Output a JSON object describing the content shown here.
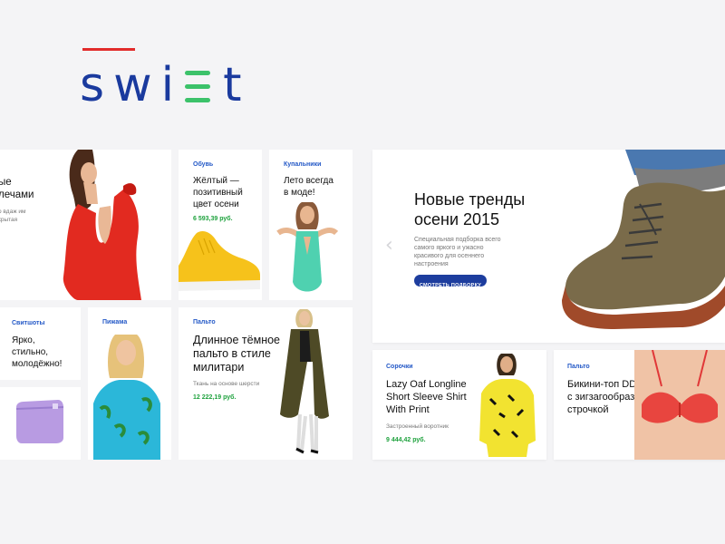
{
  "brand": {
    "letters_before": "sw",
    "letters_i": "i",
    "letters_after": "t",
    "color": "#1a3a9e",
    "accent_green": "#3cc26a",
    "accent_red": "#e22b2b"
  },
  "cards": {
    "hero_left": {
      "title_line1": "ые",
      "title_line2": "лечами",
      "sub_line1": "о вдаж им",
      "sub_line2": "крытая"
    },
    "shoes": {
      "category": "Обувь",
      "title_line1": "Жёлтый —",
      "title_line2": "позитивный",
      "title_line3": "цвет осени",
      "price": "6 593,39 руб."
    },
    "swimsuit": {
      "category": "Купальники",
      "title_line1": "Лето всегда",
      "title_line2": "в моде!"
    },
    "sweatshirt": {
      "category": "Свитшоты",
      "title_line1": "Ярко,",
      "title_line2": "стильно,",
      "title_line3": "молодёжно!"
    },
    "pajama": {
      "category": "Пижама"
    },
    "coat": {
      "category": "Пальто",
      "title_line1": "Длинное тёмное",
      "title_line2": "пальто в стиле",
      "title_line3": "милитари",
      "sub": "Ткань на основе шерсти",
      "price": "12 222,19 руб."
    },
    "hero": {
      "title_line1": "Новые тренды",
      "title_line2": "осени 2015",
      "sub_line1": "Специальная подборка всего",
      "sub_line2": "самого яркого и ужасно",
      "sub_line3": "красивого для осеннего",
      "sub_line4": "настроения",
      "button": "СМОТРЕТЬ ПОДБОРКУ",
      "prev_arrow": "‹"
    },
    "shirt": {
      "category": "Сорочки",
      "title_line1": "Lazy Oaf Longline",
      "title_line2": "Short Sleeve Shirt",
      "title_line3": "With Print",
      "sub": "Застроенный воротник",
      "price": "9 444,42 руб."
    },
    "bikini": {
      "category": "Пальто",
      "title_line1": "Бикини-топ DD-G",
      "title_line2": "с зигзагообразной",
      "title_line3": "строчкой"
    }
  },
  "icons": {
    "pouch": "purple-pouch-icon",
    "sneaker": "yellow-sneaker-icon",
    "boot": "brown-boot-icon"
  }
}
